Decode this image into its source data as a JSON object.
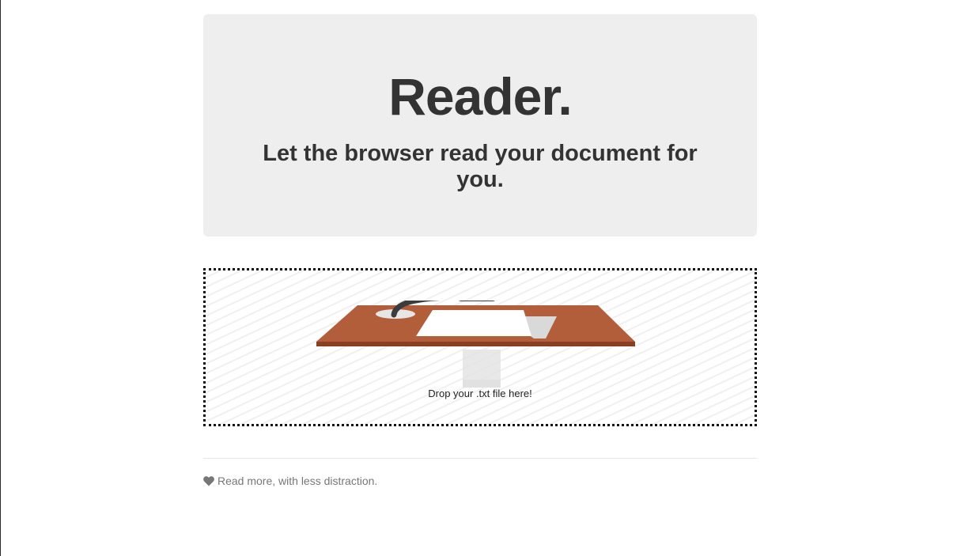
{
  "hero": {
    "title": "Reader.",
    "subtitle": "Let the browser read your document for you."
  },
  "dropzone": {
    "text": "Drop your .txt file here!",
    "illustration_icon": "desk-with-paper-and-lamp-icon"
  },
  "footer": {
    "icon": "heart-icon",
    "text": "Read more, with less distraction."
  },
  "colors": {
    "hero_background": "#eeeeee",
    "desk": "#b35e3a",
    "desk_edge": "#8a3f22",
    "text": "#333333",
    "footer_text": "#777777"
  }
}
